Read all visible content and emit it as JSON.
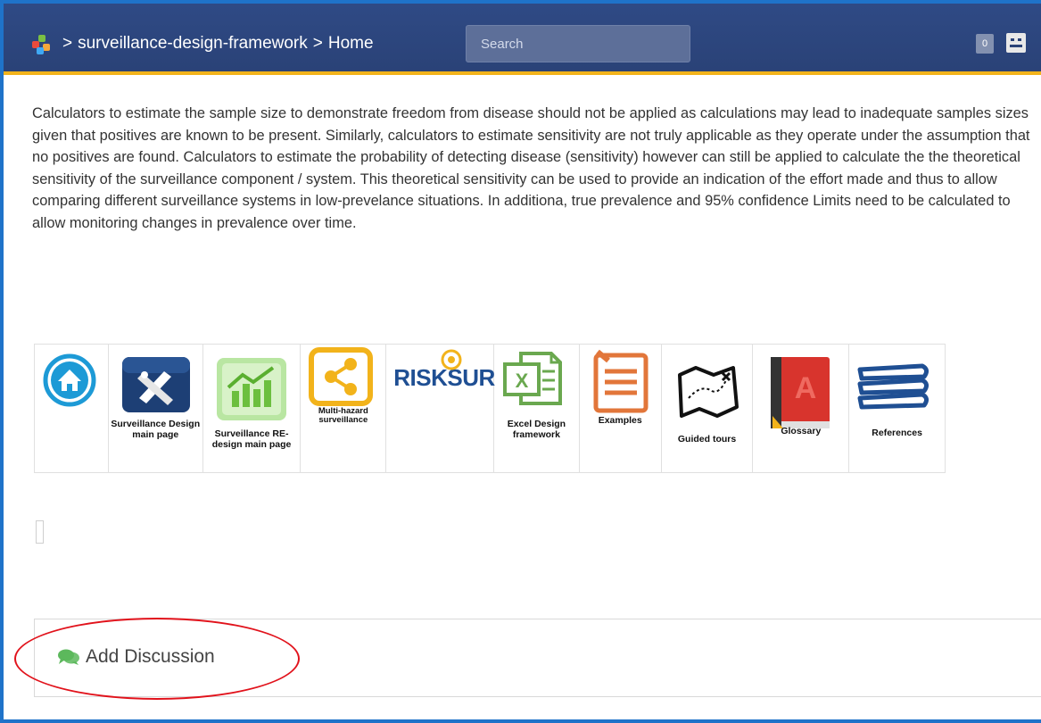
{
  "header": {
    "breadcrumb": [
      ">",
      "surveillance-design-framework",
      ">",
      "Home"
    ],
    "search_placeholder": "Search",
    "notification_count": "0"
  },
  "main": {
    "paragraph": "Calculators to estimate the sample size to demonstrate freedom from disease should not be applied as calculations may lead to inadequate samples sizes given that positives are known to be present. Similarly, calculators to estimate sensitivity are not truly applicable as they operate under the assumption that no positives are found. Calculators to estimate the probability of detecting disease (sensitivity) however can still be applied to calculate the the theoretical sensitivity of the surveillance component / system. This theoretical sensitivity can be used to provide an indication of the effort made and thus to allow comparing different surveillance systems in low-prevelance situations. In additiona, true prevalence and 95% confidence Limits need to be calculated to allow monitoring changes in prevalence over time.",
    "icons": [
      {
        "name": "home-icon",
        "label": ""
      },
      {
        "name": "surveillance-design-icon",
        "label": "Surveillance Design main page"
      },
      {
        "name": "surveillance-redesign-icon",
        "label": "Surveillance RE-design main page"
      },
      {
        "name": "share-icon",
        "label": "Multi-hazard surveillance"
      },
      {
        "name": "risksur-logo",
        "label": "RISKSUR"
      },
      {
        "name": "excel-icon",
        "label": "Excel Design framework"
      },
      {
        "name": "clipboard-icon",
        "label": "Examples"
      },
      {
        "name": "map-icon",
        "label": "Guided tours"
      },
      {
        "name": "book-icon",
        "label": "Glossary"
      },
      {
        "name": "books-stack-icon",
        "label": "References"
      }
    ]
  },
  "discussion": {
    "add_label": "Add Discussion"
  },
  "colors": {
    "header_bg": "#2a4277",
    "header_accent": "#f2b31b",
    "frame_border": "#1f73c9",
    "annotation_red": "#e1121b",
    "comment_icon_green": "#5cb85c"
  }
}
